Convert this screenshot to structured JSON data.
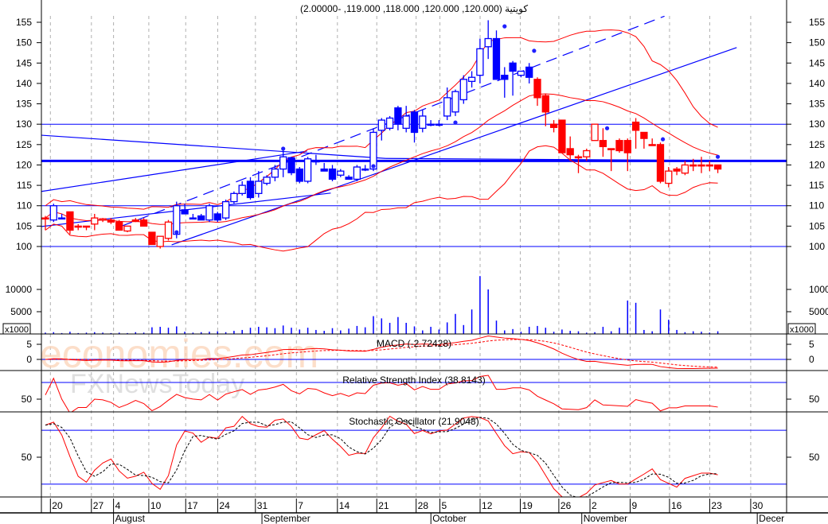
{
  "chart_data": {
    "type": "candlestick",
    "title": "كويتية (120.000, 120.000, 118.000, 119.000, -2.00000)",
    "colors": {
      "up_trend": "#0000ff",
      "down_trend": "#ff0000",
      "bands": "#ff0000",
      "lines": "#0000ff",
      "grid": "#b0b0b0"
    },
    "price_axis": {
      "ylim": [
        97,
        158
      ],
      "ticks": [
        100,
        105,
        110,
        115,
        120,
        125,
        130,
        135,
        140,
        145,
        150,
        155
      ]
    },
    "candles_ohlc_color": [
      [
        107,
        107.5,
        104,
        107,
        "r"
      ],
      [
        106.5,
        110.5,
        106,
        110,
        "b"
      ],
      [
        107,
        108,
        107,
        107,
        "b"
      ],
      [
        108.5,
        108.5,
        103,
        104,
        "r"
      ],
      [
        105,
        105.5,
        104,
        105,
        "r"
      ],
      [
        105,
        105,
        104,
        105,
        "r"
      ],
      [
        105.5,
        108,
        104,
        107,
        "r"
      ],
      [
        106.5,
        107,
        106,
        106.8,
        "r"
      ],
      [
        106.5,
        107,
        105.5,
        106,
        "r"
      ],
      [
        106,
        106.5,
        104,
        104,
        "r"
      ],
      [
        103.8,
        105,
        103.5,
        105,
        "r"
      ],
      [
        106.5,
        107,
        106,
        106.5,
        "r"
      ],
      [
        106.5,
        107,
        105,
        105,
        "r"
      ],
      [
        103.5,
        103.5,
        101.5,
        100.5,
        "r"
      ],
      [
        100,
        102.5,
        99.5,
        102.5,
        "r"
      ],
      [
        102,
        106.5,
        101.5,
        106,
        "r"
      ],
      [
        103,
        111,
        102,
        110,
        "b"
      ],
      [
        109,
        110.5,
        108,
        108,
        "b"
      ],
      [
        107,
        108,
        107,
        107,
        "b"
      ],
      [
        107.5,
        108,
        106.5,
        106.5,
        "b"
      ],
      [
        106.5,
        110.5,
        106,
        110,
        "b"
      ],
      [
        108,
        108.5,
        106,
        106.5,
        "b"
      ],
      [
        107,
        111.5,
        106.5,
        111,
        "b"
      ],
      [
        111,
        113.5,
        110.5,
        113,
        "b"
      ],
      [
        113,
        116,
        112.5,
        115,
        "b"
      ],
      [
        116,
        117,
        111.5,
        112,
        "b"
      ],
      [
        113,
        118.5,
        112,
        116,
        "b"
      ],
      [
        115.5,
        117.5,
        115,
        117,
        "b"
      ],
      [
        117,
        120,
        116,
        119,
        "b"
      ],
      [
        119,
        124,
        117,
        122,
        "b"
      ],
      [
        121.8,
        122,
        117.5,
        118.1,
        "b"
      ],
      [
        119,
        119.5,
        115.5,
        116,
        "b"
      ],
      [
        116,
        122,
        115.5,
        121.5,
        "b"
      ],
      [
        121,
        122.5,
        120,
        121,
        "b"
      ],
      [
        119,
        120.5,
        118.5,
        118.5,
        "b"
      ],
      [
        119,
        120,
        116,
        116.5,
        "b"
      ],
      [
        117.5,
        119,
        117,
        118.5,
        "b"
      ],
      [
        117,
        117.5,
        116.5,
        116.5,
        "b"
      ],
      [
        116.5,
        120,
        116,
        119.5,
        "b"
      ],
      [
        119,
        120,
        118.5,
        119,
        "b"
      ],
      [
        119,
        129,
        118.5,
        128,
        "b"
      ],
      [
        128.5,
        131.5,
        126,
        131,
        "b"
      ],
      [
        129,
        132,
        128.5,
        131.5,
        "b"
      ],
      [
        134,
        134.5,
        128.5,
        130,
        "b"
      ],
      [
        129,
        134.5,
        128,
        132,
        "b"
      ],
      [
        133,
        133.5,
        125.5,
        128,
        "b"
      ],
      [
        129,
        133.5,
        128,
        132,
        "b"
      ],
      [
        130,
        131,
        129.5,
        130,
        "b"
      ],
      [
        130,
        131,
        129.5,
        130,
        "b"
      ],
      [
        132,
        139,
        131,
        136.5,
        "b"
      ],
      [
        133,
        138.5,
        132,
        138,
        "b"
      ],
      [
        136,
        142,
        135,
        141,
        "b"
      ],
      [
        140.5,
        143,
        139,
        141.5,
        "b"
      ],
      [
        142,
        151,
        140,
        148.5,
        "b"
      ],
      [
        149,
        155.5,
        146,
        151,
        "b"
      ],
      [
        151,
        153,
        142,
        141,
        "b"
      ],
      [
        142,
        144,
        136.5,
        141,
        "b"
      ],
      [
        145,
        145.5,
        137,
        143,
        "b"
      ],
      [
        142,
        143,
        141.5,
        143,
        "b"
      ],
      [
        144,
        145,
        140,
        141.5,
        "b"
      ],
      [
        141,
        141.5,
        134.5,
        136.5,
        "r"
      ],
      [
        137,
        137.5,
        129.5,
        133,
        "r"
      ],
      [
        130,
        131,
        128,
        129.2,
        "r"
      ],
      [
        131,
        131,
        123,
        123,
        "r"
      ],
      [
        124,
        127,
        121,
        122.5,
        "r"
      ],
      [
        122,
        122.5,
        118,
        122,
        "r"
      ],
      [
        122,
        124,
        121,
        123.5,
        "r"
      ],
      [
        126,
        130,
        126,
        130,
        "r"
      ],
      [
        126,
        129,
        122,
        124.5,
        "r"
      ],
      [
        124,
        124,
        118.5,
        124,
        "r"
      ],
      [
        126,
        126.5,
        123,
        123.5,
        "r"
      ],
      [
        126,
        126.5,
        118.5,
        123,
        "r"
      ],
      [
        130.5,
        131.5,
        124,
        128.5,
        "r"
      ],
      [
        128,
        128,
        124,
        126.5,
        "r"
      ],
      [
        125,
        126.5,
        125,
        125,
        "r"
      ],
      [
        125,
        125.5,
        115.5,
        116,
        "r"
      ],
      [
        115.5,
        119.5,
        114.5,
        118.5,
        "r"
      ],
      [
        119,
        119.5,
        117.5,
        118.5,
        "r"
      ],
      [
        118,
        121,
        117.5,
        120,
        "r"
      ],
      [
        120,
        121.5,
        118.5,
        120,
        "r"
      ],
      [
        120,
        122,
        118,
        120,
        "r"
      ],
      [
        120,
        121,
        118.5,
        120,
        "r"
      ],
      [
        120,
        120,
        118,
        119,
        "r"
      ]
    ],
    "signal_dots": [
      [
        16,
        103.5
      ],
      [
        29,
        124
      ],
      [
        40,
        119.7
      ],
      [
        50,
        130.4
      ],
      [
        56,
        154
      ],
      [
        59.6,
        148
      ],
      [
        68.5,
        129
      ],
      [
        75.3,
        126.3
      ],
      [
        82,
        122
      ]
    ],
    "horizontal_lines": [
      {
        "price": 130,
        "weight": "thin"
      },
      {
        "price": 121,
        "weight": "thick"
      },
      {
        "price": 110,
        "weight": "thin"
      },
      {
        "price": 100,
        "weight": "thin"
      }
    ],
    "trend_lines": [
      {
        "from": [
          9.3,
          105
        ],
        "to": [
          75.5,
          156.5
        ],
        "style": "dashed"
      },
      {
        "from": [
          15.4,
          100.4
        ],
        "to": [
          84.3,
          148.8
        ],
        "style": "solid"
      },
      {
        "from": [
          -0.5,
          113.5
        ],
        "to": [
          31.9,
          123.4
        ],
        "style": "solid"
      },
      {
        "from": [
          -0.5,
          127.3
        ],
        "to": [
          41.5,
          121.6
        ],
        "style": "solid"
      },
      {
        "from": [
          41.5,
          121.6
        ],
        "to": [
          90.4,
          121
        ],
        "style": "solid"
      },
      {
        "from": [
          -0.5,
          104.9
        ],
        "to": [
          34.8,
          113.1
        ],
        "style": "solid"
      }
    ],
    "volume": {
      "unit_label": "x1000",
      "ticks": [
        5000,
        10000
      ],
      "values": [
        300,
        400,
        200,
        500,
        200,
        300,
        400,
        300,
        200,
        300,
        200,
        400,
        300,
        1500,
        1600,
        1400,
        1700,
        500,
        300,
        400,
        500,
        600,
        400,
        700,
        900,
        1400,
        1600,
        1500,
        1300,
        1900,
        1400,
        1000,
        1400,
        900,
        700,
        1300,
        800,
        1200,
        1800,
        1500,
        4000,
        3500,
        2500,
        3800,
        2500,
        1700,
        800,
        1600,
        1000,
        2600,
        4500,
        2000,
        5500,
        13000,
        10000,
        3000,
        800,
        1100,
        500,
        1600,
        1800,
        1400,
        500,
        1000,
        700,
        600,
        300,
        400,
        1600,
        600,
        1400,
        7500,
        7000,
        900,
        600,
        5500,
        3200,
        900,
        400,
        600,
        500,
        300,
        600
      ]
    },
    "indicators": {
      "macd": {
        "label": "MACD (-2.72428)",
        "ticks": [
          5,
          0
        ]
      },
      "rsi": {
        "label": "Relative Strength Index (38.8143)",
        "ticks": [
          50
        ],
        "level_line": 70
      },
      "stochastic": {
        "label": "Stochastic Oscillator (21.9048)",
        "ticks": [
          50
        ],
        "level_lines": [
          80,
          20
        ]
      }
    },
    "x_axis": {
      "weeks": [
        {
          "label": "20",
          "day": 1
        },
        {
          "label": "27",
          "day": 6
        },
        {
          "label": "4",
          "day": 8.7
        },
        {
          "label": "10",
          "day": 13
        },
        {
          "label": "17",
          "day": 17.5
        },
        {
          "label": "24",
          "day": 21.4
        },
        {
          "label": "31",
          "day": 26
        },
        {
          "label": "7",
          "day": 31
        },
        {
          "label": "14",
          "day": 36
        },
        {
          "label": "21",
          "day": 40.8
        },
        {
          "label": "28",
          "day": 45.6
        },
        {
          "label": "5",
          "day": 48.5
        },
        {
          "label": "12",
          "day": 53.4
        },
        {
          "label": "19",
          "day": 58.3
        },
        {
          "label": "26",
          "day": 63
        },
        {
          "label": "2",
          "day": 66.8
        },
        {
          "label": "9",
          "day": 71.7
        },
        {
          "label": "16",
          "day": 76.5
        },
        {
          "label": "23",
          "day": 81.4
        },
        {
          "label": "30",
          "day": 86.4
        }
      ],
      "months": [
        {
          "label": "August",
          "day": 8.7
        },
        {
          "label": "September",
          "day": 26.8
        },
        {
          "label": "October",
          "day": 47.4
        },
        {
          "label": "November",
          "day": 65.8
        },
        {
          "label": "Decer",
          "day": 87.2
        }
      ]
    },
    "watermark": {
      "line1": "economies.com",
      "line2": "FXNewsToday"
    }
  }
}
